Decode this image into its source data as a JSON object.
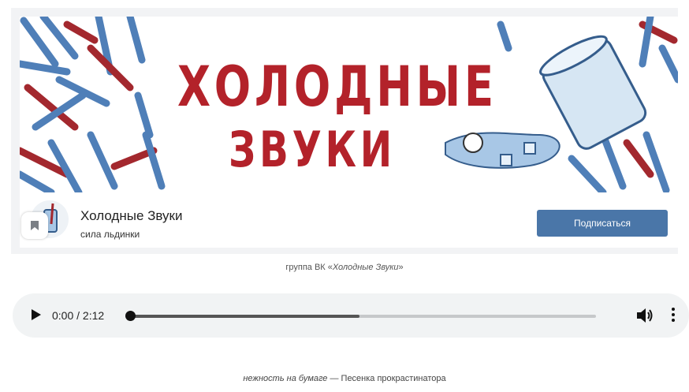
{
  "group": {
    "cover_title_line1": "ХОЛОДНЫЕ",
    "cover_title_line2": "ЗВУКИ",
    "name": "Холодные Звуки",
    "status": "сила льдинки",
    "subscribe_label": "Подписаться"
  },
  "caption1": {
    "prefix": "группа ВК «",
    "title": "Холодные Звуки",
    "suffix": "»"
  },
  "player": {
    "time_display": "0:00 / 2:12",
    "progress_buffered": 0.49,
    "progress_played": 0.0
  },
  "caption2": {
    "title": "нежность на бумаге",
    "rest": " — Песенка прокрастинатора"
  },
  "colors": {
    "accent_blue": "#4a76a8",
    "cover_red": "#b3222a",
    "stick_blue": "#4f7fb8"
  },
  "icons": [
    "play-icon",
    "volume-icon",
    "more-vert-icon",
    "bookmark-icon"
  ]
}
